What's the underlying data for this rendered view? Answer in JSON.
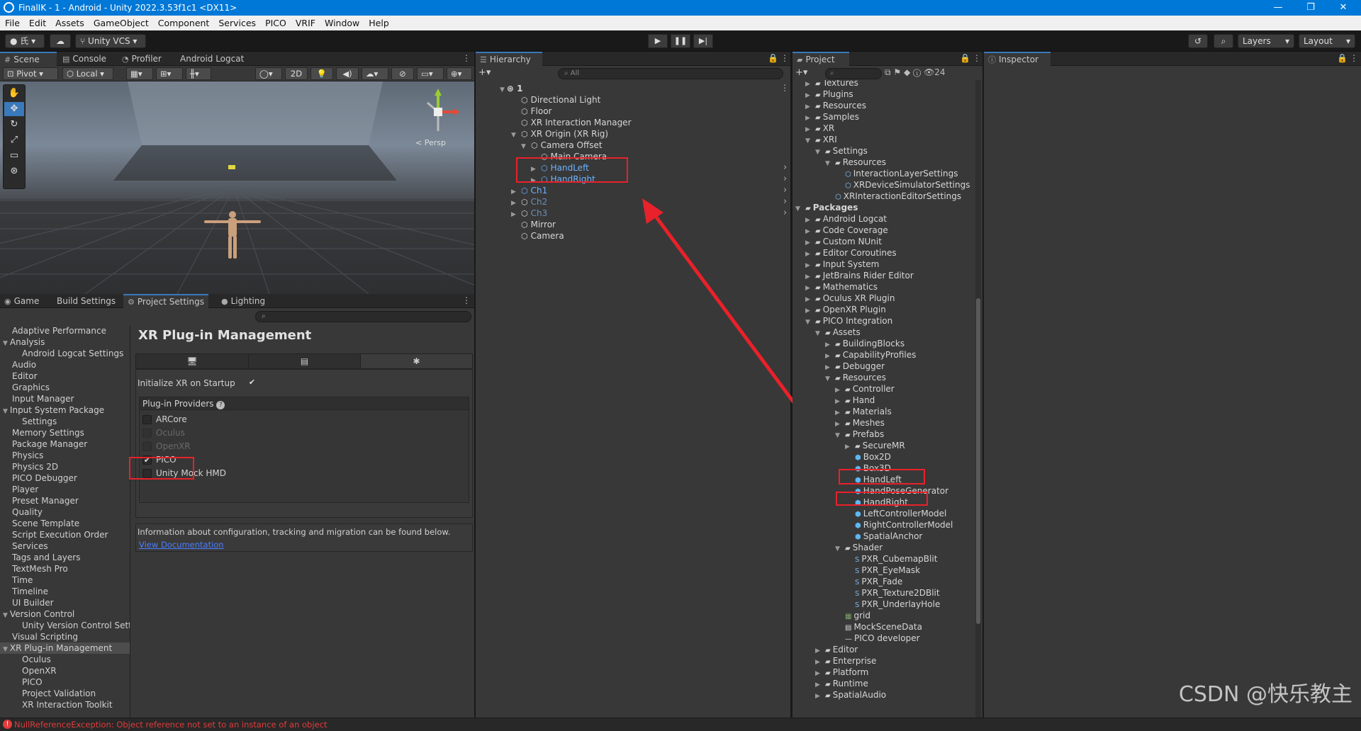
{
  "window": {
    "title": "FinalIK - 1 - Android - Unity 2022.3.53f1c1 <DX11>",
    "controls": [
      "—",
      "❐",
      "✕"
    ]
  },
  "menu": [
    "File",
    "Edit",
    "Assets",
    "GameObject",
    "Component",
    "Services",
    "PICO",
    "VRIF",
    "Window",
    "Help"
  ],
  "toolbar": {
    "account": "氏",
    "vcs": "Unity VCS",
    "layers": "Layers",
    "layout": "Layout"
  },
  "scene": {
    "tabs": [
      "Scene",
      "Console",
      "Profiler",
      "Android Logcat"
    ],
    "pivot": "Pivot",
    "local": "Local",
    "mode2d": "2D",
    "persp": "< Persp"
  },
  "bottom_tabs": [
    "Game",
    "Build Settings",
    "Project Settings",
    "Lighting"
  ],
  "project_settings": {
    "items": [
      {
        "label": "Adaptive Performance",
        "indent": 0,
        "arrow": ""
      },
      {
        "label": "Analysis",
        "indent": 0,
        "arrow": "▼"
      },
      {
        "label": "Android Logcat Settings",
        "indent": 1,
        "arrow": ""
      },
      {
        "label": "Audio",
        "indent": 0,
        "arrow": ""
      },
      {
        "label": "Editor",
        "indent": 0,
        "arrow": ""
      },
      {
        "label": "Graphics",
        "indent": 0,
        "arrow": ""
      },
      {
        "label": "Input Manager",
        "indent": 0,
        "arrow": ""
      },
      {
        "label": "Input System Package",
        "indent": 0,
        "arrow": "▼"
      },
      {
        "label": "Settings",
        "indent": 1,
        "arrow": ""
      },
      {
        "label": "Memory Settings",
        "indent": 0,
        "arrow": ""
      },
      {
        "label": "Package Manager",
        "indent": 0,
        "arrow": ""
      },
      {
        "label": "Physics",
        "indent": 0,
        "arrow": ""
      },
      {
        "label": "Physics 2D",
        "indent": 0,
        "arrow": ""
      },
      {
        "label": "PICO Debugger",
        "indent": 0,
        "arrow": ""
      },
      {
        "label": "Player",
        "indent": 0,
        "arrow": ""
      },
      {
        "label": "Preset Manager",
        "indent": 0,
        "arrow": ""
      },
      {
        "label": "Quality",
        "indent": 0,
        "arrow": ""
      },
      {
        "label": "Scene Template",
        "indent": 0,
        "arrow": ""
      },
      {
        "label": "Script Execution Order",
        "indent": 0,
        "arrow": ""
      },
      {
        "label": "Services",
        "indent": 0,
        "arrow": ""
      },
      {
        "label": "Tags and Layers",
        "indent": 0,
        "arrow": ""
      },
      {
        "label": "TextMesh Pro",
        "indent": 0,
        "arrow": ""
      },
      {
        "label": "Time",
        "indent": 0,
        "arrow": ""
      },
      {
        "label": "Timeline",
        "indent": 0,
        "arrow": ""
      },
      {
        "label": "UI Builder",
        "indent": 0,
        "arrow": ""
      },
      {
        "label": "Version Control",
        "indent": 0,
        "arrow": "▼"
      },
      {
        "label": "Unity Version Control Settings",
        "indent": 1,
        "arrow": ""
      },
      {
        "label": "Visual Scripting",
        "indent": 0,
        "arrow": ""
      },
      {
        "label": "XR Plug-in Management",
        "indent": 0,
        "arrow": "▼",
        "selected": true
      },
      {
        "label": "Oculus",
        "indent": 1,
        "arrow": ""
      },
      {
        "label": "OpenXR",
        "indent": 1,
        "arrow": ""
      },
      {
        "label": "PICO",
        "indent": 1,
        "arrow": ""
      },
      {
        "label": "Project Validation",
        "indent": 1,
        "arrow": ""
      },
      {
        "label": "XR Interaction Toolkit",
        "indent": 1,
        "arrow": ""
      }
    ],
    "heading": "XR Plug-in Management",
    "init_label": "Initialize XR on Startup",
    "providers_label": "Plug-in Providers",
    "providers": [
      {
        "label": "ARCore",
        "checked": false,
        "disabled": false
      },
      {
        "label": "Oculus",
        "checked": false,
        "disabled": true
      },
      {
        "label": "OpenXR",
        "checked": false,
        "disabled": true
      },
      {
        "label": "PICO",
        "checked": true,
        "disabled": false
      },
      {
        "label": "Unity Mock HMD",
        "checked": false,
        "disabled": false
      }
    ],
    "info": "Information about configuration, tracking and migration can be found below.",
    "doc_link": "View Documentation"
  },
  "hierarchy": {
    "tab": "Hierarchy",
    "search": "All",
    "scene_name": "1",
    "rows": [
      {
        "label": "Directional Light",
        "depth": 1,
        "arrow": "",
        "style": ""
      },
      {
        "label": "Floor",
        "depth": 1,
        "arrow": "",
        "style": ""
      },
      {
        "label": "XR Interaction Manager",
        "depth": 1,
        "arrow": "",
        "style": ""
      },
      {
        "label": "XR Origin (XR Rig)",
        "depth": 1,
        "arrow": "▼",
        "style": ""
      },
      {
        "label": "Camera Offset",
        "depth": 2,
        "arrow": "▼",
        "style": ""
      },
      {
        "label": "Main Camera",
        "depth": 3,
        "arrow": "",
        "style": ""
      },
      {
        "label": "HandLeft",
        "depth": 3,
        "arrow": "▶",
        "style": "blue"
      },
      {
        "label": "HandRight",
        "depth": 3,
        "arrow": "▶",
        "style": "blue"
      },
      {
        "label": "Ch1",
        "depth": 1,
        "arrow": "▶",
        "style": "blue"
      },
      {
        "label": "Ch2",
        "depth": 1,
        "arrow": "▶",
        "style": "dim"
      },
      {
        "label": "Ch3",
        "depth": 1,
        "arrow": "▶",
        "style": "dim"
      },
      {
        "label": "Mirror",
        "depth": 1,
        "arrow": "",
        "style": ""
      },
      {
        "label": "Camera",
        "depth": 1,
        "arrow": "",
        "style": ""
      }
    ]
  },
  "project": {
    "tab": "Project",
    "count": "24",
    "rows": [
      {
        "label": "Textures",
        "depth": 1,
        "arrow": "▶",
        "icon": "folder"
      },
      {
        "label": "Plugins",
        "depth": 1,
        "arrow": "▶",
        "icon": "folder"
      },
      {
        "label": "Resources",
        "depth": 1,
        "arrow": "▶",
        "icon": "folder"
      },
      {
        "label": "Samples",
        "depth": 1,
        "arrow": "▶",
        "icon": "folder"
      },
      {
        "label": "XR",
        "depth": 1,
        "arrow": "▶",
        "icon": "folder"
      },
      {
        "label": "XRI",
        "depth": 1,
        "arrow": "▼",
        "icon": "folder"
      },
      {
        "label": "Settings",
        "depth": 2,
        "arrow": "▼",
        "icon": "folder"
      },
      {
        "label": "Resources",
        "depth": 3,
        "arrow": "▼",
        "icon": "folder"
      },
      {
        "label": "InteractionLayerSettings",
        "depth": 4,
        "arrow": "",
        "icon": "asset"
      },
      {
        "label": "XRDeviceSimulatorSettings",
        "depth": 4,
        "arrow": "",
        "icon": "asset"
      },
      {
        "label": "XRInteractionEditorSettings",
        "depth": 3,
        "arrow": "",
        "icon": "asset"
      },
      {
        "label": "Packages",
        "depth": 0,
        "arrow": "▼",
        "icon": "folder",
        "bold": true
      },
      {
        "label": "Android Logcat",
        "depth": 1,
        "arrow": "▶",
        "icon": "folder"
      },
      {
        "label": "Code Coverage",
        "depth": 1,
        "arrow": "▶",
        "icon": "folder"
      },
      {
        "label": "Custom NUnit",
        "depth": 1,
        "arrow": "▶",
        "icon": "folder"
      },
      {
        "label": "Editor Coroutines",
        "depth": 1,
        "arrow": "▶",
        "icon": "folder"
      },
      {
        "label": "Input System",
        "depth": 1,
        "arrow": "▶",
        "icon": "folder"
      },
      {
        "label": "JetBrains Rider Editor",
        "depth": 1,
        "arrow": "▶",
        "icon": "folder"
      },
      {
        "label": "Mathematics",
        "depth": 1,
        "arrow": "▶",
        "icon": "folder"
      },
      {
        "label": "Oculus XR Plugin",
        "depth": 1,
        "arrow": "▶",
        "icon": "folder"
      },
      {
        "label": "OpenXR Plugin",
        "depth": 1,
        "arrow": "▶",
        "icon": "folder"
      },
      {
        "label": "PICO Integration",
        "depth": 1,
        "arrow": "▼",
        "icon": "folder"
      },
      {
        "label": "Assets",
        "depth": 2,
        "arrow": "▼",
        "icon": "folder"
      },
      {
        "label": "BuildingBlocks",
        "depth": 3,
        "arrow": "▶",
        "icon": "folder"
      },
      {
        "label": "CapabilityProfiles",
        "depth": 3,
        "arrow": "▶",
        "icon": "folder"
      },
      {
        "label": "Debugger",
        "depth": 3,
        "arrow": "▶",
        "icon": "folder"
      },
      {
        "label": "Resources",
        "depth": 3,
        "arrow": "▼",
        "icon": "folder"
      },
      {
        "label": "Controller",
        "depth": 4,
        "arrow": "▶",
        "icon": "folder"
      },
      {
        "label": "Hand",
        "depth": 4,
        "arrow": "▶",
        "icon": "folder"
      },
      {
        "label": "Materials",
        "depth": 4,
        "arrow": "▶",
        "icon": "folder"
      },
      {
        "label": "Meshes",
        "depth": 4,
        "arrow": "▶",
        "icon": "folder"
      },
      {
        "label": "Prefabs",
        "depth": 4,
        "arrow": "▼",
        "icon": "folder"
      },
      {
        "label": "SecureMR",
        "depth": 5,
        "arrow": "▶",
        "icon": "folder"
      },
      {
        "label": "Box2D",
        "depth": 5,
        "arrow": "",
        "icon": "prefab"
      },
      {
        "label": "Box3D",
        "depth": 5,
        "arrow": "",
        "icon": "prefab"
      },
      {
        "label": "HandLeft",
        "depth": 5,
        "arrow": "",
        "icon": "prefab"
      },
      {
        "label": "HandPoseGenerator",
        "depth": 5,
        "arrow": "",
        "icon": "prefab"
      },
      {
        "label": "HandRight",
        "depth": 5,
        "arrow": "",
        "icon": "prefab"
      },
      {
        "label": "LeftControllerModel",
        "depth": 5,
        "arrow": "",
        "icon": "prefab"
      },
      {
        "label": "RightControllerModel",
        "depth": 5,
        "arrow": "",
        "icon": "prefab"
      },
      {
        "label": "SpatialAnchor",
        "depth": 5,
        "arrow": "",
        "icon": "prefab"
      },
      {
        "label": "Shader",
        "depth": 4,
        "arrow": "▼",
        "icon": "folder"
      },
      {
        "label": "PXR_CubemapBlit",
        "depth": 5,
        "arrow": "",
        "icon": "shader"
      },
      {
        "label": "PXR_EyeMask",
        "depth": 5,
        "arrow": "",
        "icon": "shader"
      },
      {
        "label": "PXR_Fade",
        "depth": 5,
        "arrow": "",
        "icon": "shader"
      },
      {
        "label": "PXR_Texture2DBlit",
        "depth": 5,
        "arrow": "",
        "icon": "shader"
      },
      {
        "label": "PXR_UnderlayHole",
        "depth": 5,
        "arrow": "",
        "icon": "shader"
      },
      {
        "label": "grid",
        "depth": 4,
        "arrow": "",
        "icon": "texture"
      },
      {
        "label": "MockSceneData",
        "depth": 4,
        "arrow": "",
        "icon": "file"
      },
      {
        "label": "PICO developer",
        "depth": 4,
        "arrow": "",
        "icon": "line"
      },
      {
        "label": "Editor",
        "depth": 2,
        "arrow": "▶",
        "icon": "folder"
      },
      {
        "label": "Enterprise",
        "depth": 2,
        "arrow": "▶",
        "icon": "folder"
      },
      {
        "label": "Platform",
        "depth": 2,
        "arrow": "▶",
        "icon": "folder"
      },
      {
        "label": "Runtime",
        "depth": 2,
        "arrow": "▶",
        "icon": "folder"
      },
      {
        "label": "SpatialAudio",
        "depth": 2,
        "arrow": "▶",
        "icon": "folder"
      }
    ]
  },
  "inspector": {
    "tab": "Inspector"
  },
  "status": {
    "error": "NullReferenceException: Object reference not set to an instance of an object"
  },
  "watermark": "CSDN @快乐教主",
  "colors": {
    "accent": "#3a79bb",
    "highlight": "#e8212a",
    "link": "#4c7eff",
    "selected_text": "#6cb4ff",
    "error": "#e03c3c"
  }
}
